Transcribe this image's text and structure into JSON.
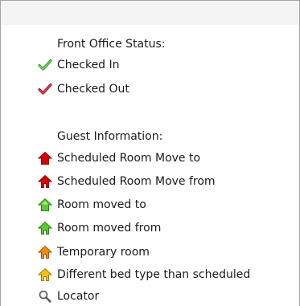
{
  "legend": {
    "front_office": {
      "heading": "Front Office Status:",
      "items": [
        {
          "label": "Checked In",
          "icon": "green-check-icon",
          "color": "#3aa832"
        },
        {
          "label": "Checked Out",
          "icon": "red-check-icon",
          "color": "#c8102e"
        }
      ]
    },
    "guest_information": {
      "heading": "Guest Information:",
      "items": [
        {
          "label": "Scheduled Room Move to",
          "icon": "red-house-solid-icon",
          "color": "#d40000"
        },
        {
          "label": "Scheduled Room Move from",
          "icon": "red-house-outline-icon",
          "color": "#d40000"
        },
        {
          "label": "Room moved to",
          "icon": "green-house-solid-icon",
          "color": "#5cc832"
        },
        {
          "label": "Room moved from",
          "icon": "green-house-outline-icon",
          "color": "#5cc832"
        },
        {
          "label": "Temporary room",
          "icon": "orange-house-icon",
          "color": "#f08a1c"
        },
        {
          "label": "Different bed type than scheduled",
          "icon": "yellow-house-icon",
          "color": "#f2c316"
        },
        {
          "label": "Locator",
          "icon": "magnifier-icon",
          "color": "#555555"
        }
      ]
    }
  }
}
